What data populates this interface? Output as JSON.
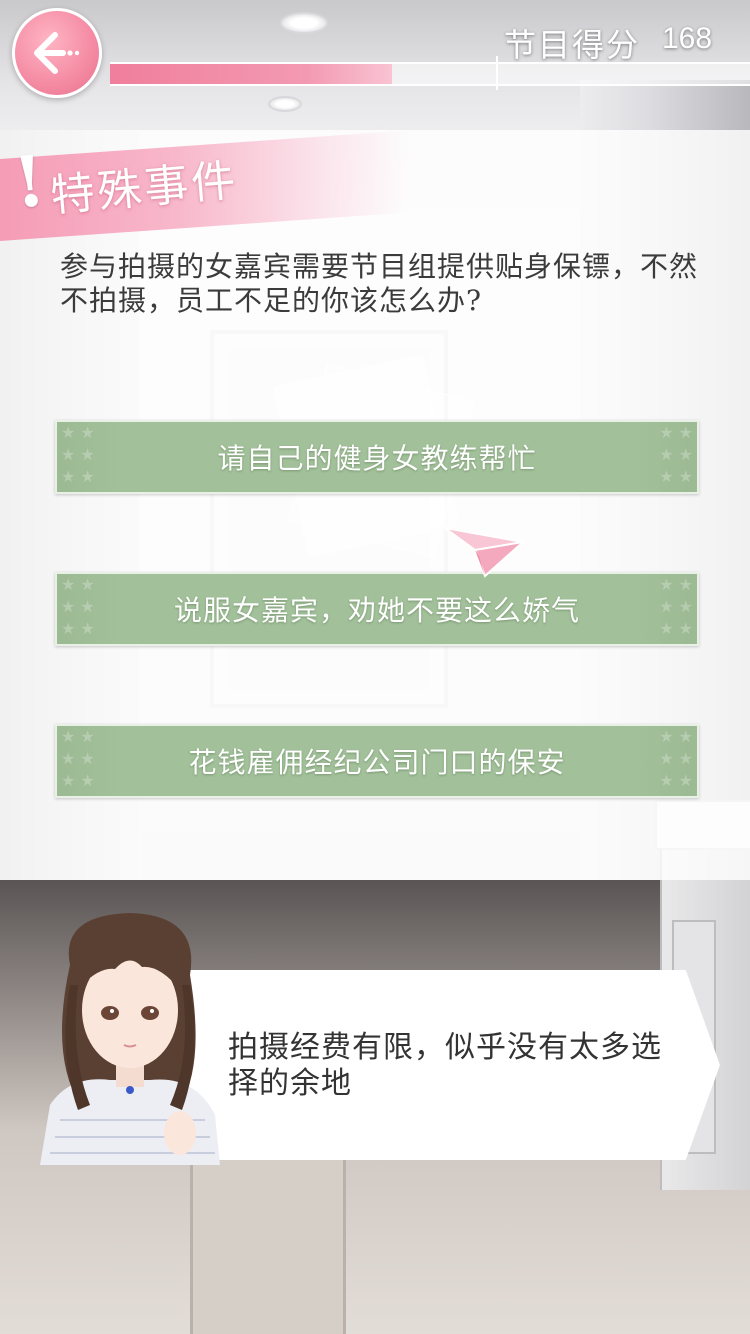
{
  "hud": {
    "score_label": "节目得分",
    "score_value": "168",
    "score_progress": 0.44
  },
  "event": {
    "title": "特殊事件",
    "mark": "!",
    "question": "参与拍摄的女嘉宾需要节目组提供贴身保镖，不然不拍摄，员工不足的你该怎么办?"
  },
  "choices": [
    {
      "label": "请自己的健身女教练帮忙"
    },
    {
      "label": "说服女嘉宾，劝她不要这么娇气"
    },
    {
      "label": "花钱雇佣经纪公司门口的保安"
    }
  ],
  "dialog": {
    "text": "拍摄经费有限，似乎没有太多选择的余地"
  },
  "colors": {
    "accent_pink": "#f48aa3",
    "choice_green": "#a2c09a"
  },
  "icons": {
    "back": "arrow-left-icon",
    "plane": "paper-plane-icon"
  }
}
